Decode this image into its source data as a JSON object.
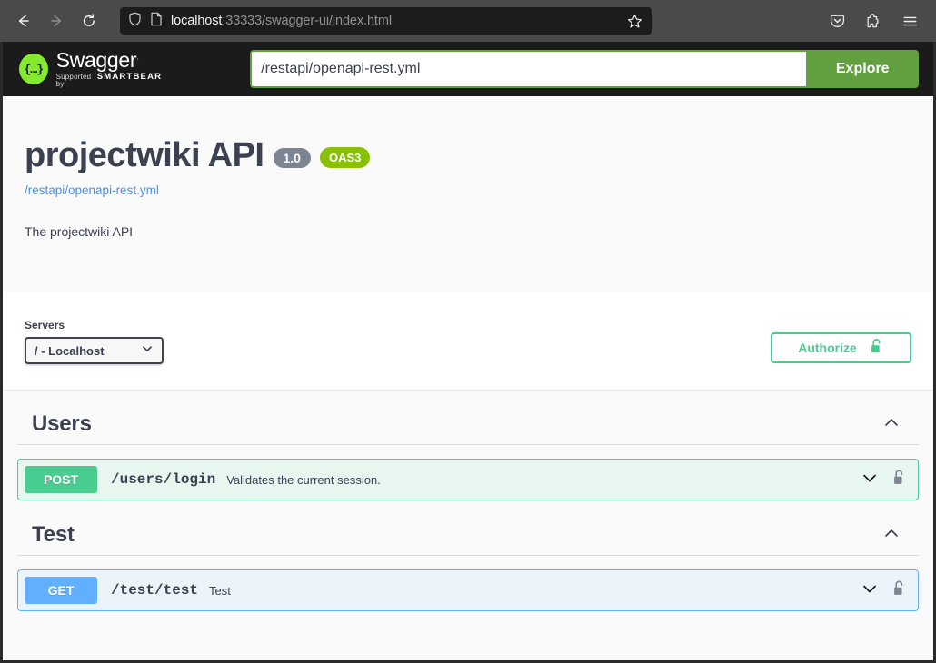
{
  "browser": {
    "nav": {
      "back": "back-arrow",
      "forward": "forward-arrow",
      "reload": "reload"
    },
    "url": {
      "host": "localhost",
      "path": ":33333/swagger-ui/index.html",
      "full": "localhost:33333/swagger-ui/index.html"
    },
    "toolbar_icons": [
      "pocket-icon",
      "extensions-icon",
      "menu-icon"
    ]
  },
  "topbar": {
    "logo_text": "Swagger",
    "logo_tm": ".",
    "logo_supported_prefix": "Supported by",
    "logo_brand": "SMARTBEAR",
    "spec_url_value": "/restapi/openapi-rest.yml",
    "spec_url_placeholder": "Explore the spec URL",
    "explore_label": "Explore"
  },
  "info": {
    "title": "projectwiki API",
    "version": "1.0",
    "oas_badge": "OAS3",
    "spec_link": "/restapi/openapi-rest.yml",
    "description": "The projectwiki API"
  },
  "servers": {
    "label": "Servers",
    "selected": "/ - Localhost",
    "options": [
      "/ - Localhost"
    ]
  },
  "authorize": {
    "label": "Authorize",
    "lock_state": "unlocked"
  },
  "tags": [
    {
      "name": "Users",
      "expanded": true,
      "operations": [
        {
          "method": "POST",
          "path": "/users/login",
          "summary": "Validates the current session.",
          "lock_state": "unlocked"
        }
      ]
    },
    {
      "name": "Test",
      "expanded": true,
      "operations": [
        {
          "method": "GET",
          "path": "/test/test",
          "summary": "Test",
          "lock_state": "unlocked"
        }
      ]
    }
  ],
  "colors": {
    "post": "#49cc90",
    "get": "#61affe",
    "oas": "#89bf04",
    "version": "#7d8492",
    "explore": "#62a03f",
    "link": "#4a90e2",
    "text": "#3b4151"
  }
}
